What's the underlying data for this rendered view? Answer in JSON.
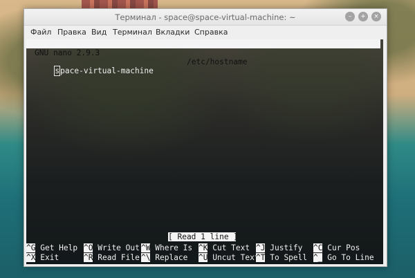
{
  "window": {
    "title": "Терминал - space@space-virtual-machine: ~",
    "buttons": {
      "minimize": "–",
      "maximize": "+",
      "close": "×"
    }
  },
  "menubar": {
    "items": [
      "Файл",
      "Правка",
      "Вид",
      "Терминал",
      "Вкладки",
      "Справка"
    ]
  },
  "nano": {
    "version": "GNU nano 2.9.3",
    "filename": "/etc/hostname",
    "content_first_char": "s",
    "content_rest": "pace-virtual-machine",
    "status": "[ Read 1 line ]",
    "shortcuts_row1": [
      {
        "key": "^G",
        "label": "Get Help"
      },
      {
        "key": "^O",
        "label": "Write Out"
      },
      {
        "key": "^W",
        "label": "Where Is"
      },
      {
        "key": "^K",
        "label": "Cut Text"
      },
      {
        "key": "^J",
        "label": "Justify"
      },
      {
        "key": "^C",
        "label": "Cur Pos"
      }
    ],
    "shortcuts_row2": [
      {
        "key": "^X",
        "label": "Exit"
      },
      {
        "key": "^R",
        "label": "Read File"
      },
      {
        "key": "^\\",
        "label": "Replace"
      },
      {
        "key": "^U",
        "label": "Uncut Text"
      },
      {
        "key": "^T",
        "label": "To Spell"
      },
      {
        "key": "^_",
        "label": "Go To Line"
      }
    ]
  }
}
